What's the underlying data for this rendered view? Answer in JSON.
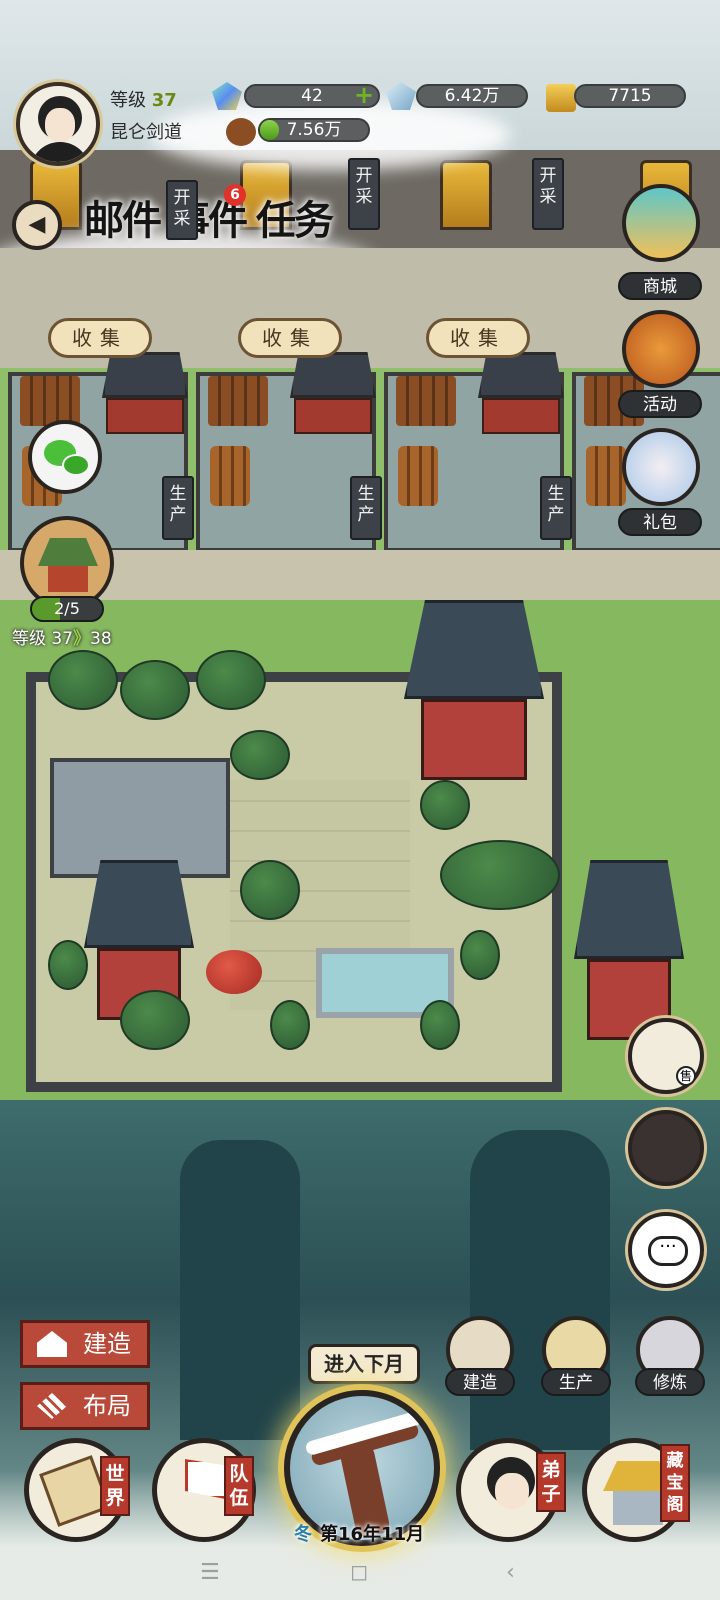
{
  "player": {
    "level_label": "等级",
    "level": "37",
    "sect_name": "昆仑剑道"
  },
  "resources": {
    "spirit_stone": "42",
    "crystal": "6.42万",
    "gold": "7715",
    "wood": "7.56万",
    "plus_symbol": "+"
  },
  "top_buttons": {
    "mail": "邮件",
    "events": "事件",
    "events_badge": "6",
    "tasks": "任务"
  },
  "mining_tags": [
    "开采",
    "开采",
    "开采"
  ],
  "right_menu": {
    "shop": "商城",
    "activity": "活动",
    "gift": "礼包"
  },
  "workshops": {
    "collect_label": "收集",
    "produce_label": "生产"
  },
  "sect_progress": {
    "count": "2/5",
    "level_from_label": "等级 37",
    "arrow": "》",
    "level_to": "38",
    "fraction": 0.4
  },
  "left_actions": {
    "build": "建造",
    "layout": "布局"
  },
  "quick_actions": {
    "build": "建造",
    "produce": "生产",
    "cultivate": "修炼"
  },
  "shop_sign": "售",
  "chat_symbol": "···",
  "next_month": "进入下月",
  "date": {
    "season": "冬",
    "text": "第16年11月"
  },
  "bottom_nav": {
    "world": "世界",
    "team": "队伍",
    "disciples": "弟子",
    "treasury": "藏宝阁"
  },
  "system_nav": {
    "menu": "☰",
    "home": "◻",
    "back": "‹"
  },
  "icons": [
    "back-arrow-icon",
    "wechat-icon",
    "sect-hall-icon",
    "build-house-icon",
    "layout-tiles-icon",
    "hammer-icon",
    "wheat-icon",
    "cultivator-icon",
    "scroll-map-icon",
    "flag-icon",
    "disciple-icon",
    "treasure-pavilion-icon",
    "shop-icon",
    "lantern-icon",
    "fist-icon",
    "chat-icon"
  ],
  "colors": {
    "accent_red": "#b94a3a",
    "resource_green": "#6bb526",
    "badge_red": "#e0322b"
  }
}
